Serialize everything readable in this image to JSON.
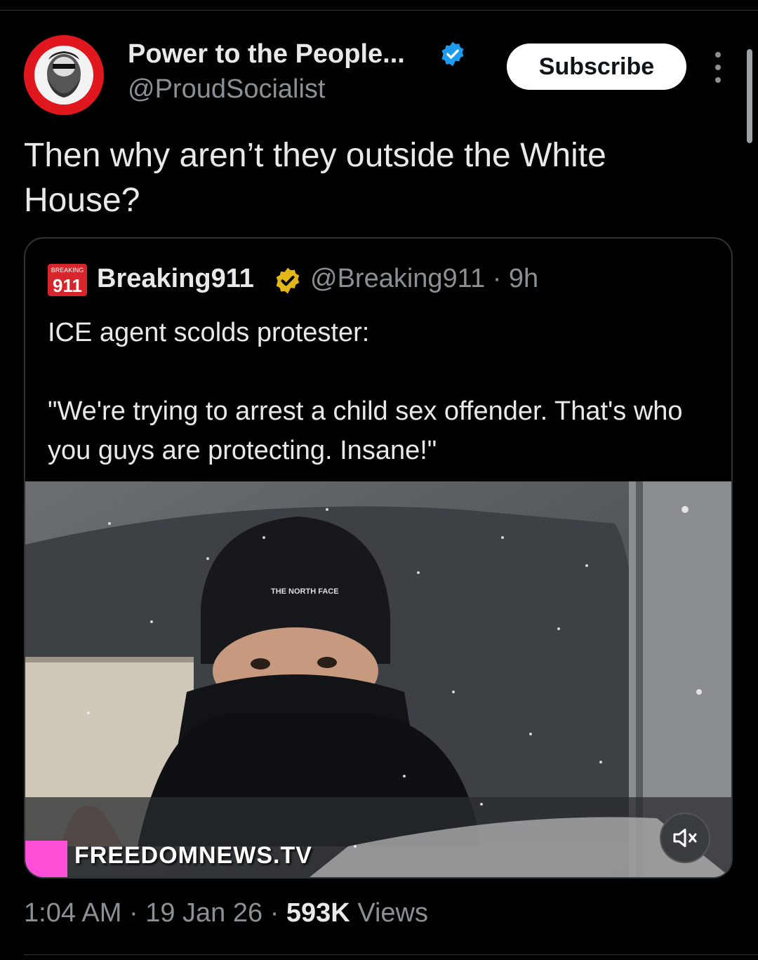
{
  "post": {
    "author_name": "Power to the People...",
    "handle": "@ProudSocialist",
    "subscribe_label": "Subscribe",
    "text": "Then why aren’t they outside the White House?",
    "time": "1:04 AM",
    "sep": "·",
    "date": "19 Jan 26",
    "views_count": "593K",
    "views_label": "Views"
  },
  "quote": {
    "logo_text_top": "BREAKING",
    "logo_text_main": "911",
    "author_name": "Breaking911",
    "handle_time": "@Breaking911 · 9h",
    "text": "ICE agent scolds protester:\n\n\"We're trying to arrest a child sex offender. That's who you guys are protecting. Insane!\"",
    "video": {
      "watermark": "FREEDOMNEWS.TV",
      "hat_logo": "THE NORTH FACE",
      "mute_icon": "speaker-muted-icon"
    }
  },
  "colors": {
    "verified_blue": "#1d9bf0",
    "verified_gold": "#e2b719",
    "avatar_ring": "#e0181e",
    "logo_red": "#d7262b",
    "watermark_pink": "#ff4fd8"
  }
}
